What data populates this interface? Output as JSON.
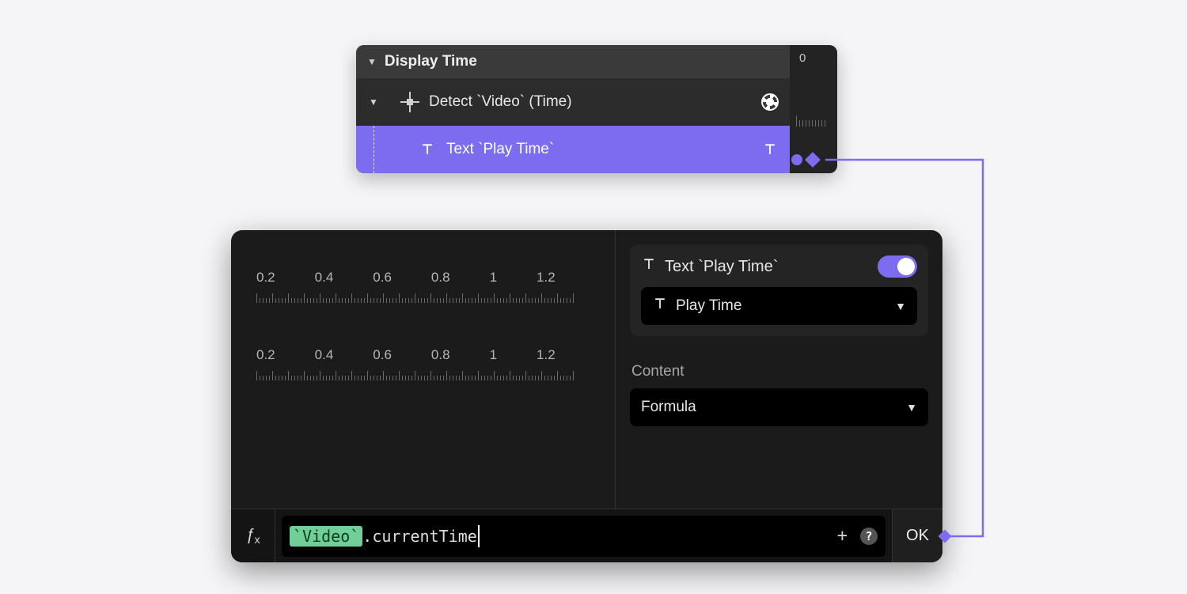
{
  "colors": {
    "accent": "#7c6cf0",
    "formula_token_bg": "#6fcf97"
  },
  "top_panel": {
    "group_title": "Display Time",
    "side_label": "0",
    "rows": [
      {
        "id": "detect",
        "label": "Detect `Video` (Time)",
        "right_icon": "reel-icon"
      },
      {
        "id": "text",
        "label": "Text `Play Time`",
        "right_icon": "text-icon"
      }
    ]
  },
  "ruler": {
    "labels": [
      "0.2",
      "0.4",
      "0.6",
      "0.8",
      "1",
      "1.2"
    ]
  },
  "inspector": {
    "title": "Text `Play Time`",
    "toggle_on": true,
    "target_select": "Play Time",
    "section_label": "Content",
    "content_type": "Formula"
  },
  "formula": {
    "token": "`Video`",
    "rest": ".currentTime",
    "ok_label": "OK"
  }
}
